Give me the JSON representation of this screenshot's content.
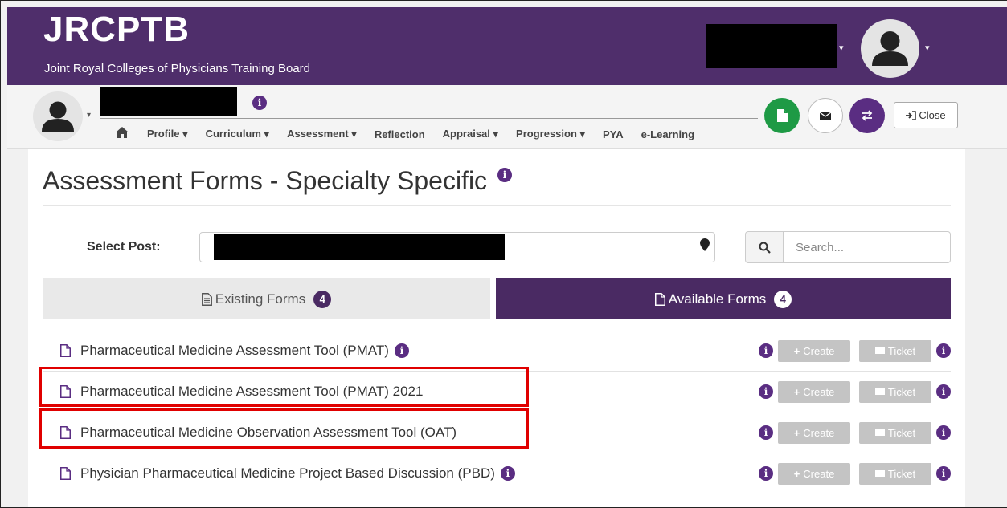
{
  "brand": {
    "title": "JRCPTB",
    "subtitle": "Joint Royal Colleges of Physicians Training Board"
  },
  "nav": {
    "items": [
      "Profile ▾",
      "Curriculum ▾",
      "Assessment ▾",
      "Reflection",
      "Appraisal ▾",
      "Progression ▾",
      "PYA",
      "e-Learning"
    ],
    "close_label": "Close"
  },
  "page": {
    "title": "Assessment Forms - Specialty Specific",
    "select_post_label": "Select Post:",
    "search_placeholder": "Search..."
  },
  "tabs": {
    "existing": {
      "label": "Existing Forms",
      "count": "4"
    },
    "available": {
      "label": "Available Forms",
      "count": "4"
    }
  },
  "forms": [
    {
      "name": "Pharmaceutical Medicine Assessment Tool (PMAT)",
      "info": true,
      "highlighted": false
    },
    {
      "name": "Pharmaceutical Medicine Assessment Tool (PMAT) 2021",
      "info": false,
      "highlighted": true
    },
    {
      "name": "Pharmaceutical Medicine Observation Assessment Tool (OAT)",
      "info": false,
      "highlighted": true
    },
    {
      "name": "Physician Pharmaceutical Medicine Project Based Discussion (PBD)",
      "info": true,
      "highlighted": false
    }
  ],
  "actions": {
    "create_label": "Create",
    "ticket_label": "Ticket"
  },
  "colors": {
    "brand_purple": "#4f2e6b",
    "accent_purple": "#5a2d82",
    "green": "#1e9a45",
    "highlight_red": "#e00000",
    "disabled_button": "#c4c4c4"
  }
}
